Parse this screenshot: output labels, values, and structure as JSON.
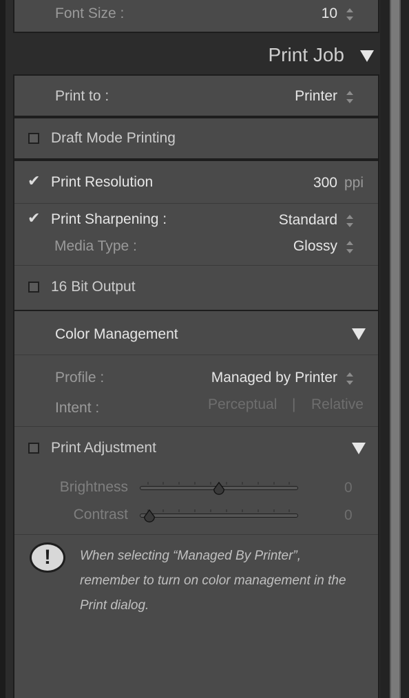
{
  "font_size": {
    "label": "Font Size :",
    "value": "10"
  },
  "print_job": {
    "title": "Print Job"
  },
  "print_to": {
    "label": "Print to :",
    "value": "Printer"
  },
  "draft_mode": {
    "label": "Draft Mode Printing",
    "checked": false
  },
  "print_resolution": {
    "label": "Print Resolution",
    "checked": true,
    "value": "300",
    "unit": "ppi"
  },
  "print_sharpening": {
    "label": "Print Sharpening :",
    "checked": true,
    "value": "Standard"
  },
  "media_type": {
    "label": "Media Type :",
    "value": "Glossy"
  },
  "bit_output": {
    "label": "16 Bit Output",
    "checked": false
  },
  "color_management": {
    "title": "Color Management",
    "profile_label": "Profile :",
    "profile_value": "Managed by Printer",
    "intent_label": "Intent :",
    "intent_options": [
      "Perceptual",
      "Relative"
    ],
    "separator": "|"
  },
  "print_adjustment": {
    "label": "Print Adjustment",
    "checked": false,
    "brightness": {
      "label": "Brightness",
      "value": "0",
      "position": 0.5
    },
    "contrast": {
      "label": "Contrast",
      "value": "0",
      "position": 0.0
    }
  },
  "warning": {
    "icon_glyph": "!",
    "lines": [
      "When selecting “Managed By Printer”,",
      "remember to turn on color management in the",
      "Print dialog."
    ]
  },
  "icons": {
    "checkmark": "✔"
  }
}
